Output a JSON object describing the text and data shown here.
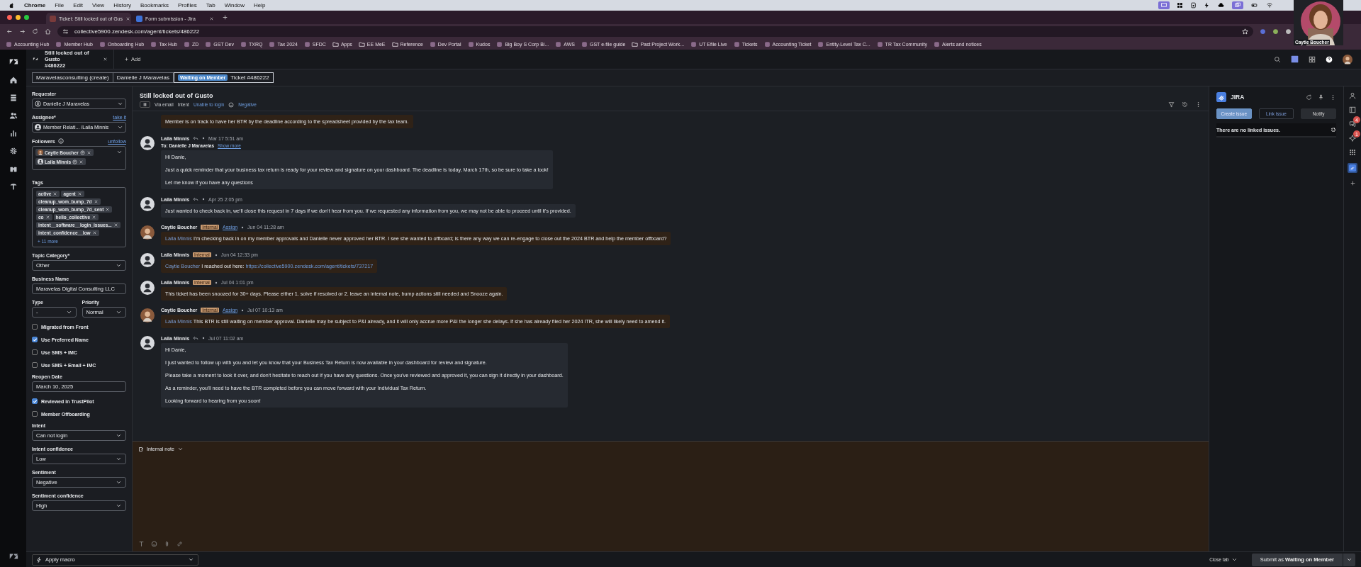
{
  "mac_menu": {
    "app": "Chrome",
    "items": [
      "File",
      "Edit",
      "View",
      "History",
      "Bookmarks",
      "Profiles",
      "Tab",
      "Window",
      "Help"
    ]
  },
  "browser_tabs": [
    {
      "title": "Ticket: Still locked out of Gus",
      "selected": true
    },
    {
      "title": "Form submission - Jira",
      "selected": false
    }
  ],
  "address": "collective5900.zendesk.com/agent/tickets/486222",
  "bookmarks": [
    {
      "label": "Accounting Hub",
      "kind": "site"
    },
    {
      "label": "Member Hub",
      "kind": "site"
    },
    {
      "label": "Onboarding Hub",
      "kind": "site"
    },
    {
      "label": "Tax Hub",
      "kind": "site"
    },
    {
      "label": "ZD",
      "kind": "site"
    },
    {
      "label": "GST Dev",
      "kind": "site"
    },
    {
      "label": "TXRQ",
      "kind": "site"
    },
    {
      "label": "Tax 2024",
      "kind": "site"
    },
    {
      "label": "SFDC",
      "kind": "site"
    },
    {
      "label": "Apps",
      "kind": "folder"
    },
    {
      "label": "EE MeE",
      "kind": "folder"
    },
    {
      "label": "Reference",
      "kind": "folder"
    },
    {
      "label": "Dev Portal",
      "kind": "site"
    },
    {
      "label": "Kudos",
      "kind": "site"
    },
    {
      "label": "Big Boy S Corp Bi...",
      "kind": "site"
    },
    {
      "label": "AWS",
      "kind": "site"
    },
    {
      "label": "GST e-file guide",
      "kind": "site"
    },
    {
      "label": "Past Project Work...",
      "kind": "folder"
    },
    {
      "label": "UT Efile Live",
      "kind": "site"
    },
    {
      "label": "Tickets",
      "kind": "site"
    },
    {
      "label": "Accounting Ticket",
      "kind": "site"
    },
    {
      "label": "Entity-Level Tax C...",
      "kind": "site"
    },
    {
      "label": "TR Tax Community",
      "kind": "site"
    },
    {
      "label": "Alerts and notices",
      "kind": "site"
    }
  ],
  "webcam": {
    "kind": "picture",
    "name": "Caytie Boucher"
  },
  "ticket_tab": {
    "title": "Still locked out of Gusto",
    "number": "#486222",
    "add": "Add"
  },
  "breadcrumbs": [
    {
      "label": "Maravelasconsulting (create)"
    },
    {
      "label": "Danielle J Maravelas"
    },
    {
      "badge": "Waiting on Member",
      "label": "Ticket #486222"
    }
  ],
  "sidebar": {
    "fields": [
      {
        "kind": "user",
        "label": "Requester",
        "value": "Danielle J Maravelas",
        "avatar": {
          "kind": "outline"
        }
      },
      {
        "kind": "user",
        "label": "Assignee*",
        "action": "take it",
        "value": "Member Relati... /Laila Minnis",
        "avatar": {
          "kind": "default"
        }
      },
      {
        "kind": "followers",
        "label": "Followers",
        "action": "unfollow",
        "chips": [
          {
            "name": "Caytie Boucher"
          },
          {
            "name": "Laila Minnis",
            "avatar": {
              "kind": "default"
            }
          }
        ]
      },
      {
        "kind": "tags",
        "label": "Tags",
        "chips": [
          "active",
          "agent",
          "cleanup_wom_bump_7d",
          "cleanup_wom_bump_7d_sent",
          "co",
          "hello_collective",
          "intent__software__login_issues...",
          "intent_confidence__low"
        ],
        "more": "+ 11 more"
      },
      {
        "kind": "select",
        "label": "Topic Category*",
        "value": "Other"
      },
      {
        "kind": "input",
        "label": "Business Name",
        "value": "Maravelas Digital Consulting LLC"
      },
      {
        "kind": "pair",
        "items": [
          {
            "label": "Type",
            "value": "-"
          },
          {
            "label": "Priority",
            "value": "Normal"
          }
        ]
      },
      {
        "kind": "checkbox",
        "label": "Migrated from Front",
        "checked": false
      },
      {
        "kind": "checkbox",
        "label": "Use Preferred Name",
        "checked": true
      },
      {
        "kind": "checkbox",
        "label": "Use SMS + IMC",
        "checked": false
      },
      {
        "kind": "checkbox",
        "label": "Use SMS + Email + IMC",
        "checked": false
      },
      {
        "kind": "input",
        "label": "Reopen Date",
        "value": "March 10, 2025"
      },
      {
        "kind": "checkbox",
        "label": "Reviewed in TrustPilot",
        "checked": true
      },
      {
        "kind": "checkbox",
        "label": "Member Offboarding",
        "checked": false
      },
      {
        "kind": "select",
        "label": "Intent",
        "value": "Can not login"
      },
      {
        "kind": "select",
        "label": "Intent confidence",
        "value": "Low"
      },
      {
        "kind": "select",
        "label": "Sentiment",
        "value": "Negative"
      },
      {
        "kind": "select",
        "label": "Sentiment confidence",
        "value": "High"
      }
    ]
  },
  "ticket": {
    "title": "Still locked out of Gusto",
    "via": "Via email",
    "intent_label": "Intent",
    "intent": "Unable to login",
    "sentiment": "Negative"
  },
  "messages": [
    {
      "kind": "internal",
      "text": "Member is on track to have her BTR by the deadline according to the spreadsheet provided by the tax team."
    },
    {
      "kind": "public",
      "author": "Laila Minnis",
      "avatar": {
        "kind": "default"
      },
      "time": "Mar 17 5:51 am",
      "to": "To: Danielle J Maravelas",
      "show_more": "Show more",
      "paragraphs": [
        "Hi Danie,",
        "Just a quick reminder that your business tax return is ready for your review and signature on your dashboard. The deadline is today, March 17th, so be sure to take a look!",
        "Let me know if you have any questions"
      ]
    },
    {
      "kind": "public",
      "author": "Laila Minnis",
      "avatar": {
        "kind": "default"
      },
      "time": "Apr 25 2:05 pm",
      "paragraphs": [
        "Just wanted to check back in, we'll close this request in 7 days if we don't hear from you. If we requested any information from you, we may not be able to proceed until it's provided."
      ]
    },
    {
      "kind": "internal",
      "author": "Caytie Boucher",
      "badge": "Internal",
      "assign": "Assign",
      "time": "Jun 04 11:28 am",
      "mention": "Laila Minnis",
      "text": "I'm checking back in on my member approvals and Danielle never approved her BTR. I see she wanted to offboard; is there any way we can re-engage to close out the 2024 BTR and help the member offboard?"
    },
    {
      "kind": "internal",
      "author": "Laila Minnis",
      "avatar": {
        "kind": "default"
      },
      "badge": "Internal",
      "time": "Jun 04 12:33 pm",
      "mention": "Caytie Boucher",
      "text": "I reached out here:",
      "link": "https://collective5900.zendesk.com/agent/tickets/737217"
    },
    {
      "kind": "internal",
      "author": "Laila Minnis",
      "avatar": {
        "kind": "default"
      },
      "badge": "Internal",
      "time": "Jul 04 1:01 pm",
      "text": "This ticket has been snoozed for 30+ days. Please either 1. solve if resolved or 2. leave an internal note, bump actions still needed and Snooze again."
    },
    {
      "kind": "internal",
      "author": "Caytie Boucher",
      "badge": "Internal",
      "assign": "Assign",
      "time": "Jul 07 10:13 am",
      "mention": "Laila Minnis",
      "text": "This BTR is still waiting on member approval. Danielle may be subject to P&I already, and it will only accrue more P&I the longer she delays. If she has already filed her 2024 ITR, she will likely need to amend it."
    },
    {
      "kind": "public",
      "author": "Laila Minnis",
      "avatar": {
        "kind": "default"
      },
      "time": "Jul 07 11:02 am",
      "paragraphs": [
        "Hi Danie,",
        "I just wanted to follow up with you and let you know that your Business Tax Return is now available in your dashboard for review and signature.",
        "Please take a moment to look it over, and don't hesitate to reach out if you have any questions. Once you've reviewed and approved it, you can sign it directly in your dashboard.",
        "As a reminder, you'll need to have the BTR completed before you can move forward with your Individual Tax Return.",
        "Looking forward to hearing from you soon!"
      ]
    }
  ],
  "composer": {
    "mode": "Internal note"
  },
  "jira": {
    "title": "JIRA",
    "buttons": [
      {
        "label": "Create issue",
        "kind": "primary"
      },
      {
        "label": "Link issue",
        "kind": "outline"
      },
      {
        "label": "Notify",
        "kind": "plain"
      }
    ],
    "empty": "There are no linked issues."
  },
  "side_strip": {
    "chat_badge": "4",
    "ai_badge": "1"
  },
  "footer": {
    "macro": "Apply macro",
    "close": "Close tab",
    "submit": "Submit as **Waiting on Member**"
  }
}
